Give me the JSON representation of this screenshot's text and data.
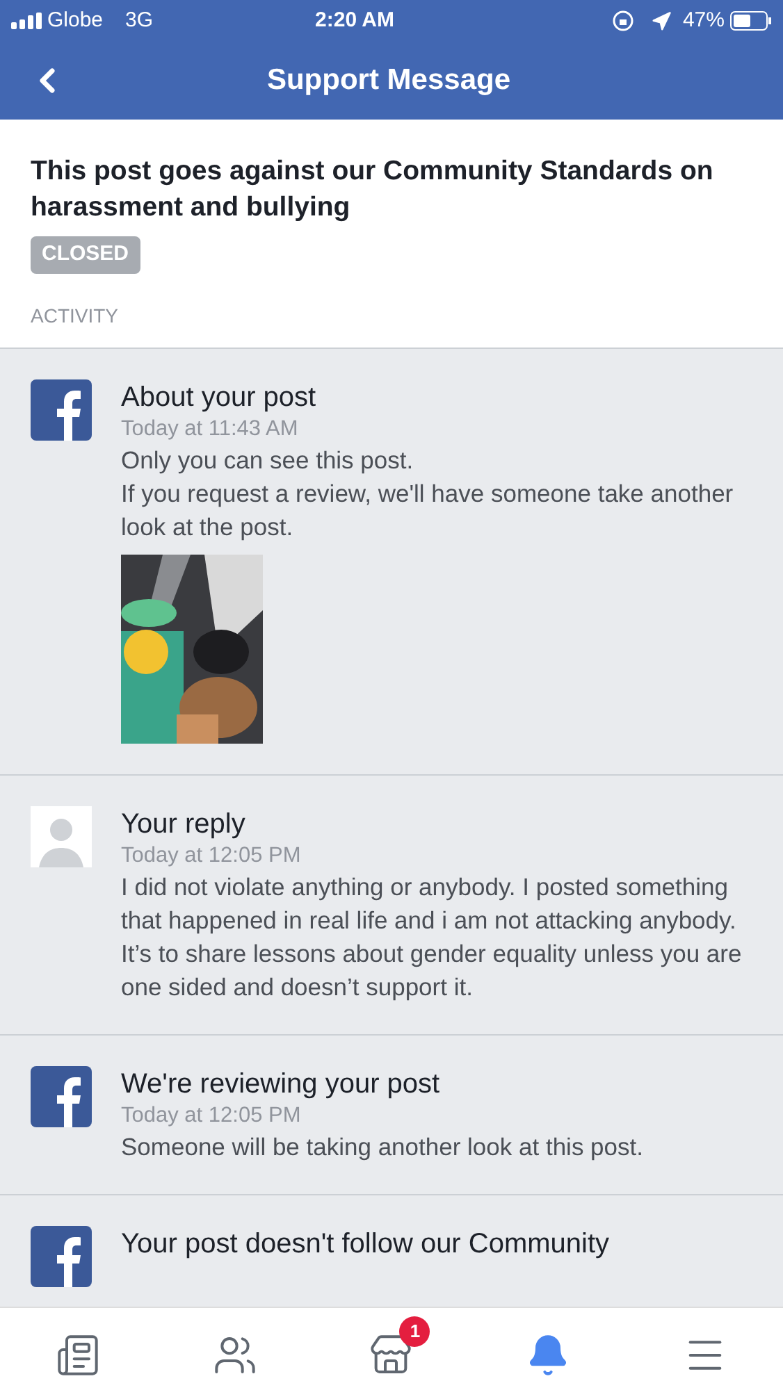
{
  "status_bar": {
    "carrier": "Globe",
    "network": "3G",
    "time": "2:20 AM",
    "battery": "47%"
  },
  "header": {
    "title": "Support Message"
  },
  "case": {
    "title": "This post goes against our Community Standards on harassment and bullying",
    "status": "CLOSED",
    "section": "ACTIVITY"
  },
  "activity": [
    {
      "kind": "logo",
      "title": "About your post",
      "time": "Today at 11:43 AM",
      "lines": [
        "Only you can see this post.",
        "If you request a review, we'll have someone take another look at the post."
      ]
    },
    {
      "kind": "person",
      "title": "Your reply",
      "time": "Today at 12:05 PM",
      "lines": [
        "I did not violate anything or anybody. I posted something that happened in real life and i am not attacking anybody. It’s to share lessons about gender equality unless you are one sided and doesn’t support it."
      ]
    },
    {
      "kind": "logo",
      "title": "We're reviewing your post",
      "time": "Today at 12:05 PM",
      "lines": [
        "Someone will be taking another look at this post."
      ]
    },
    {
      "kind": "logo",
      "title": "Your post doesn't follow our Community"
    }
  ],
  "tab_bar": [
    {
      "kind": "feed",
      "selected": false
    },
    {
      "kind": "friends",
      "selected": false
    },
    {
      "kind": "marketplace",
      "selected": false,
      "badge": "1"
    },
    {
      "kind": "notifications",
      "selected": true
    },
    {
      "kind": "menu",
      "selected": false
    }
  ]
}
